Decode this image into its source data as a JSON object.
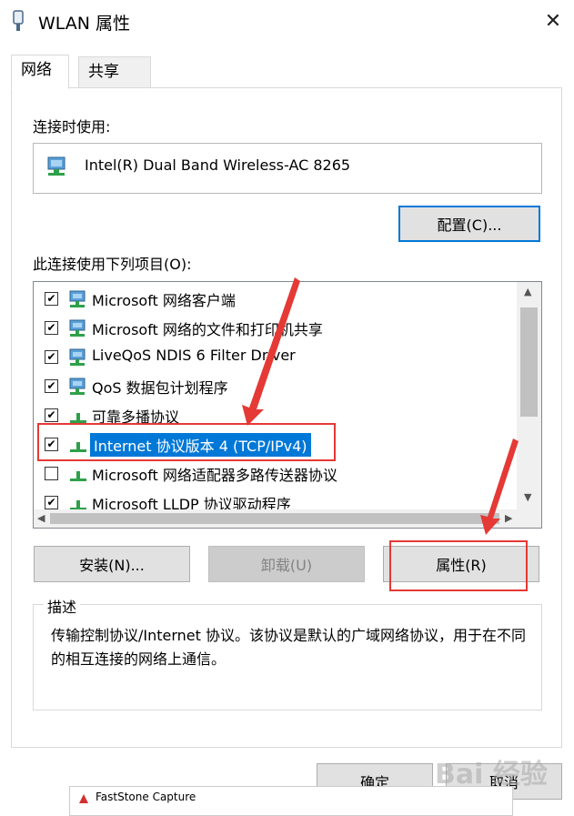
{
  "window": {
    "title": "WLAN 属性",
    "icon": "wlan-adapter-icon",
    "close_glyph": "✕"
  },
  "tabs": [
    {
      "label": "网络",
      "active": true
    },
    {
      "label": "共享",
      "active": false
    }
  ],
  "connect_using": {
    "label": "连接时使用:",
    "adapter_name": "Intel(R) Dual Band Wireless-AC 8265",
    "configure_label": "配置(C)..."
  },
  "items": {
    "label": "此连接使用下列项目(O):",
    "list": [
      {
        "label": "Microsoft 网络客户端",
        "checked": true,
        "icon": "network-client-icon"
      },
      {
        "label": "Microsoft 网络的文件和打印机共享",
        "checked": true,
        "icon": "network-client-icon"
      },
      {
        "label": "LiveQoS NDIS 6 Filter Driver",
        "checked": true,
        "icon": "network-client-icon"
      },
      {
        "label": "QoS 数据包计划程序",
        "checked": true,
        "icon": "network-client-icon"
      },
      {
        "label": "可靠多播协议",
        "checked": true,
        "icon": "protocol-icon"
      },
      {
        "label": "Internet 协议版本 4 (TCP/IPv4)",
        "checked": true,
        "icon": "protocol-icon",
        "selected": true
      },
      {
        "label": "Microsoft 网络适配器多路传送器协议",
        "checked": false,
        "icon": "protocol-icon"
      },
      {
        "label": "Microsoft LLDP 协议驱动程序",
        "checked": true,
        "icon": "protocol-icon"
      }
    ]
  },
  "buttons": {
    "install": "安装(N)...",
    "uninstall": "卸载(U)",
    "properties": "属性(R)"
  },
  "description": {
    "title": "描述",
    "text": "传输控制协议/Internet 协议。该协议是默认的广域网络协议，用于在不同的相互连接的网络上通信。"
  },
  "footer": {
    "ok": "确定",
    "cancel": "取消"
  },
  "capture_bar": {
    "title": "FastStone Capture"
  },
  "watermark": "Bai 经验",
  "colors": {
    "accent": "#0078d7",
    "annotation": "#e53935"
  }
}
